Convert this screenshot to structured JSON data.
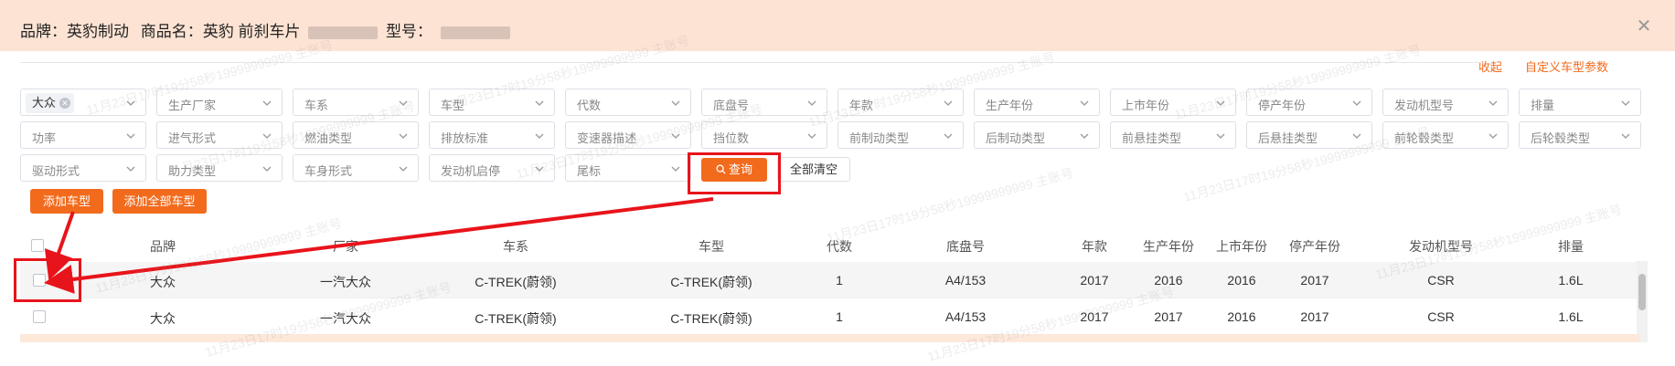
{
  "header": {
    "brand_label": "品牌：",
    "brand_value": "英豹制动",
    "product_label": "商品名：",
    "product_value": "英豹 前刹车片",
    "model_label": "型号："
  },
  "actions": {
    "collapse": "收起",
    "custom_params": "自定义车型参数",
    "add_model": "添加车型",
    "add_all_models": "添加全部车型",
    "query": "查询",
    "clear_all": "全部清空"
  },
  "filters": {
    "selected_brand": "大众",
    "fields": [
      "生产厂家",
      "车系",
      "车型",
      "代数",
      "底盘号",
      "年款",
      "生产年份",
      "上市年份",
      "停产年份",
      "发动机型号",
      "排量",
      "功率",
      "进气形式",
      "燃油类型",
      "排放标准",
      "变速器描述",
      "挡位数",
      "前制动类型",
      "后制动类型",
      "前悬挂类型",
      "后悬挂类型",
      "前轮毂类型",
      "后轮毂类型",
      "驱动形式",
      "助力类型",
      "车身形式",
      "发动机启停",
      "尾标"
    ]
  },
  "table": {
    "columns": [
      "品牌",
      "厂家",
      "车系",
      "车型",
      "代数",
      "底盘号",
      "年款",
      "生产年份",
      "上市年份",
      "停产年份",
      "发动机型号",
      "排量"
    ],
    "rows": [
      [
        "大众",
        "一汽大众",
        "C-TREK(蔚领)",
        "C-TREK(蔚领)",
        "1",
        "A4/153",
        "2017",
        "2016",
        "2016",
        "2017",
        "CSR",
        "1.6L"
      ],
      [
        "大众",
        "一汽大众",
        "C-TREK(蔚领)",
        "C-TREK(蔚领)",
        "1",
        "A4/153",
        "2017",
        "2017",
        "2016",
        "2017",
        "CSR",
        "1.6L"
      ]
    ]
  },
  "watermark_text": "11月23日17时19分58秒19999999999 主账号",
  "icons": {
    "close": "close-icon",
    "chevron": "chevron-down-icon",
    "search": "search-icon"
  },
  "colors": {
    "accent": "#f26b1d",
    "header_bg": "#fde3d3",
    "annotation": "#e8141b"
  }
}
